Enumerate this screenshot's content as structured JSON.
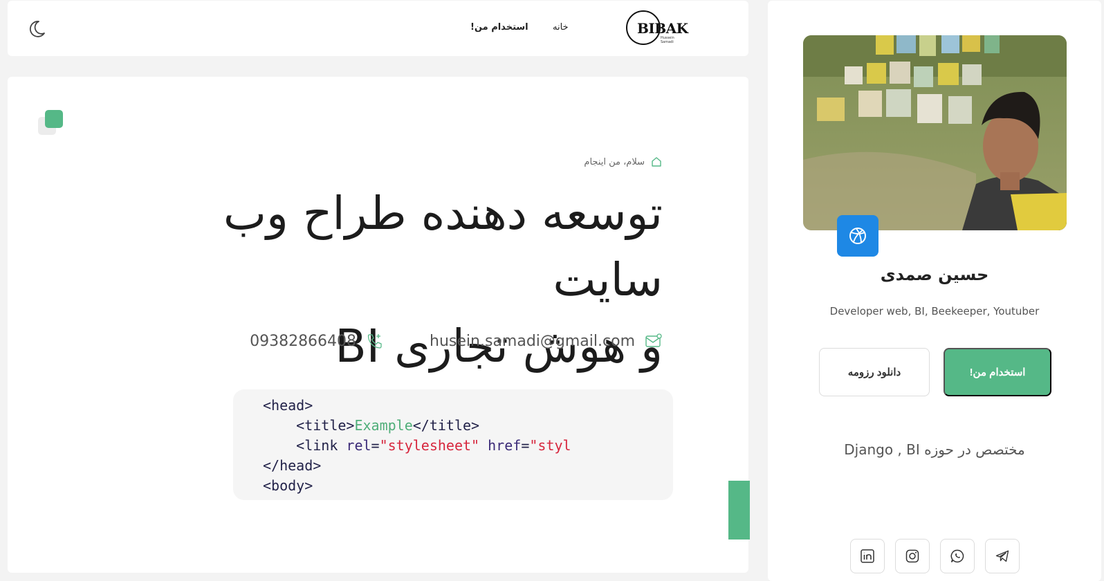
{
  "nav": {
    "logo_text": "BIBAK",
    "logo_sub": "Hussein Samadi",
    "home": "خانه",
    "hire": "استخدام من!"
  },
  "hero": {
    "breadcrumb": "سلام، من اینجام",
    "headline_line1": "توسعه دهنده طراح وب سایت",
    "headline_line2": "و هوش تجاری BI",
    "email": "husein.samadi@gmail.com",
    "phone": "09382866408"
  },
  "code": {
    "line1": "<head>",
    "line2_open": "<title>",
    "line2_text": "Example",
    "line2_close": "</title>",
    "line3_tag": "<link ",
    "line3_attr1": "rel",
    "line3_eq1": "=",
    "line3_val1": "\"stylesheet\"",
    "line3_attr2": " href",
    "line3_eq2": "=",
    "line3_val2": "\"styles.css\">",
    "line4": "</head>",
    "line5": "<body>"
  },
  "profile": {
    "name": "حسین صمدی",
    "role": "Developer web, BI, Beekeeper, Youtuber",
    "hire_button": "استخدام من!",
    "cv_button": "دانلود رزومه",
    "specialty": "مختصص در حوزه Django , BI"
  },
  "icons": {
    "theme": "moon-icon",
    "home": "home-icon",
    "mail": "mail-icon",
    "phone": "phone-icon",
    "dribbble": "dribbble-icon",
    "socials": [
      "linkedin-icon",
      "instagram-icon",
      "whatsapp-icon",
      "telegram-icon"
    ]
  },
  "colors": {
    "accent": "#55b887",
    "dribbble": "#1e88e5",
    "code_bg": "#f5f5f5"
  }
}
